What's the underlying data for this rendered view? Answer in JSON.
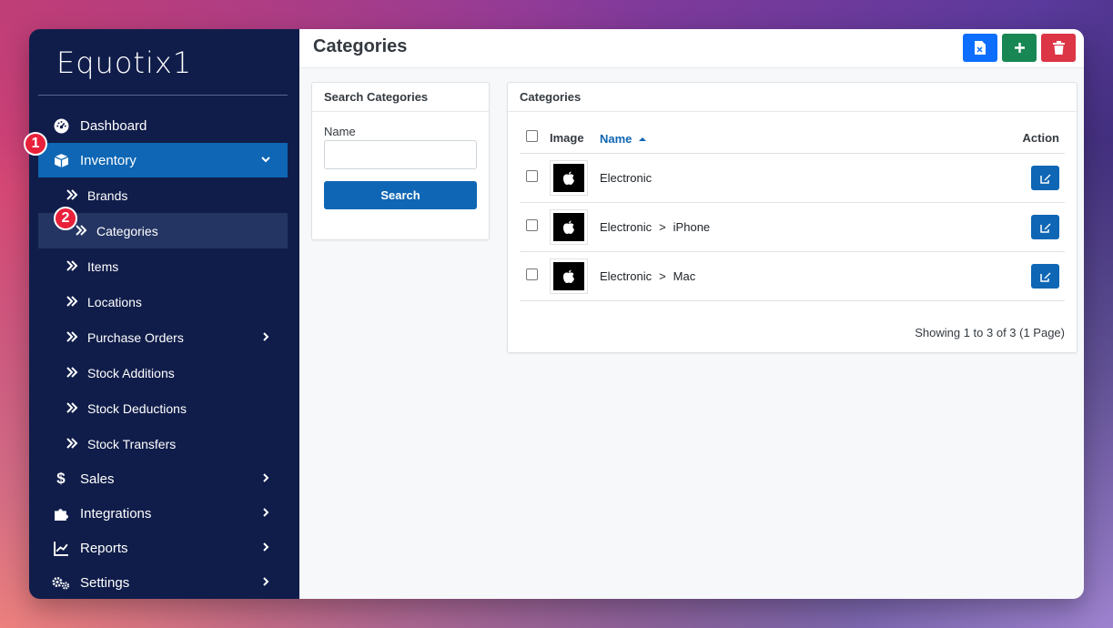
{
  "app": {
    "logo_text": "Equotix1"
  },
  "sidebar": {
    "items": [
      {
        "label": "Dashboard",
        "icon": "dashboard-icon"
      },
      {
        "label": "Inventory",
        "icon": "box-icon",
        "expanded": true,
        "active": true
      },
      {
        "label": "Sales",
        "icon": "dollar-icon"
      },
      {
        "label": "Integrations",
        "icon": "puzzle-icon"
      },
      {
        "label": "Reports",
        "icon": "chart-line-icon"
      },
      {
        "label": "Settings",
        "icon": "gears-icon"
      }
    ],
    "inventory_sub": [
      {
        "label": "Brands"
      },
      {
        "label": "Categories",
        "selected": true
      },
      {
        "label": "Items"
      },
      {
        "label": "Locations"
      },
      {
        "label": "Purchase Orders",
        "has_children": true
      },
      {
        "label": "Stock Additions"
      },
      {
        "label": "Stock Deductions"
      },
      {
        "label": "Stock Transfers"
      }
    ]
  },
  "badges": [
    "1",
    "2"
  ],
  "header": {
    "title": "Categories",
    "actions": [
      {
        "name": "export",
        "icon": "file-excel-icon",
        "color": "#0d6efd"
      },
      {
        "name": "add",
        "icon": "plus-icon",
        "color": "#198754"
      },
      {
        "name": "delete",
        "icon": "trash-icon",
        "color": "#dc3545"
      }
    ]
  },
  "search_panel": {
    "title": "Search Categories",
    "name_label": "Name",
    "name_value": "",
    "search_button": "Search"
  },
  "categories_panel": {
    "title": "Categories",
    "columns": {
      "image": "Image",
      "name": "Name",
      "action": "Action"
    },
    "rows": [
      {
        "path": [
          "Electronic"
        ]
      },
      {
        "path": [
          "Electronic",
          "iPhone"
        ]
      },
      {
        "path": [
          "Electronic",
          "Mac"
        ]
      }
    ],
    "path_separator": ">",
    "footer": "Showing 1 to 3 of 3 (1 Page)"
  },
  "colors": {
    "sidebar_bg": "#101d4a",
    "active_blue": "#0e66b4",
    "badge_red": "#e8203a"
  }
}
